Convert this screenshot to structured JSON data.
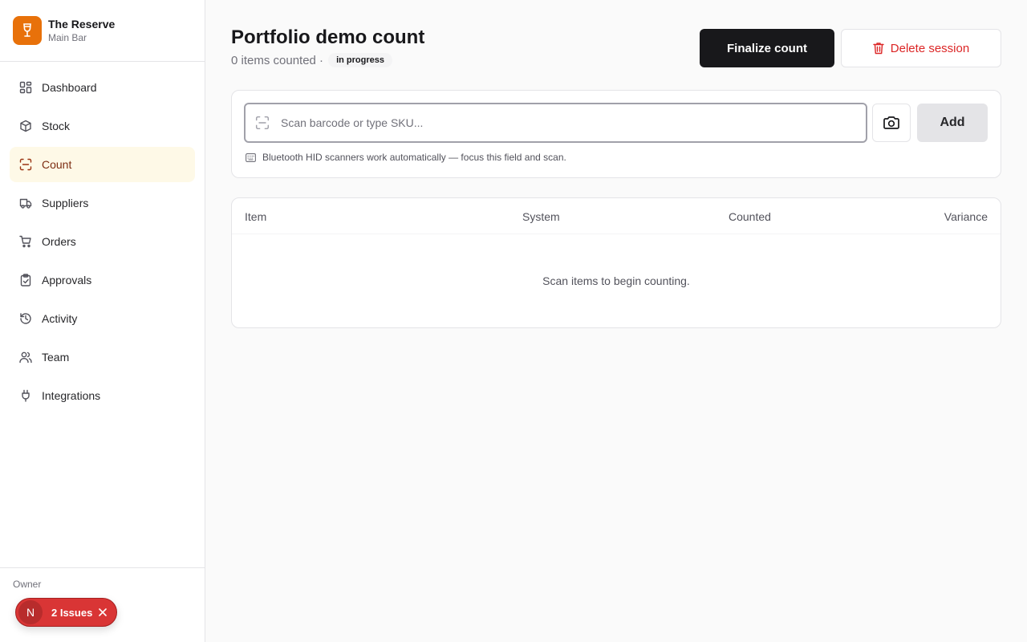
{
  "brand": {
    "name": "The Reserve",
    "location": "Main Bar",
    "logo_icon": "wine-glass-icon",
    "logo_color": "#e8710a"
  },
  "sidebar": {
    "items": [
      {
        "label": "Dashboard",
        "icon": "dashboard-icon"
      },
      {
        "label": "Stock",
        "icon": "box-icon"
      },
      {
        "label": "Count",
        "icon": "scan-icon",
        "active": true
      },
      {
        "label": "Suppliers",
        "icon": "truck-icon"
      },
      {
        "label": "Orders",
        "icon": "cart-icon"
      },
      {
        "label": "Approvals",
        "icon": "clipboard-check-icon"
      },
      {
        "label": "Activity",
        "icon": "history-icon"
      },
      {
        "label": "Team",
        "icon": "users-icon"
      },
      {
        "label": "Integrations",
        "icon": "plug-icon"
      }
    ],
    "footer": {
      "role": "Owner",
      "issues_avatar": "N",
      "issues_label": "2 Issues"
    }
  },
  "header": {
    "title": "Portfolio demo count",
    "subtitle": "0 items counted ·",
    "status": "in progress",
    "finalize_label": "Finalize count",
    "delete_label": "Delete session"
  },
  "scan": {
    "placeholder": "Scan barcode or type SKU...",
    "value": "",
    "add_label": "Add",
    "hint": "Bluetooth HID scanners work automatically — focus this field and scan."
  },
  "table": {
    "columns": [
      "Item",
      "System",
      "Counted",
      "Variance"
    ],
    "rows": [],
    "empty_message": "Scan items to begin counting."
  },
  "colors": {
    "accent": "#e8710a",
    "active_bg": "#fef9e7",
    "danger": "#dc2626",
    "primary": "#18181b",
    "issues": "#d93535"
  }
}
